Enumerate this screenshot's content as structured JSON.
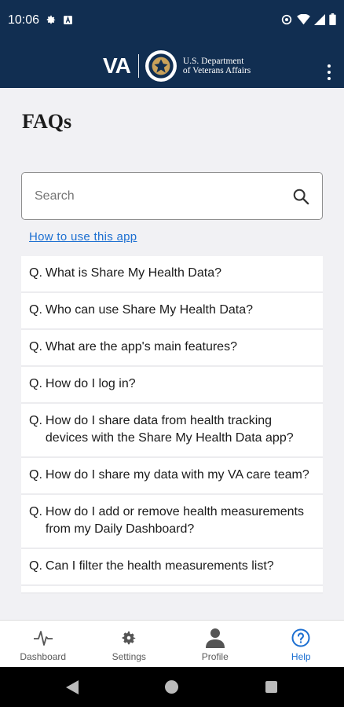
{
  "status_bar": {
    "time": "10:06"
  },
  "header": {
    "logo_mark": "VA",
    "dept_line1": "U.S. Department",
    "dept_line2": "of Veterans Affairs"
  },
  "page": {
    "title": "FAQs"
  },
  "search": {
    "placeholder": "Search",
    "value": ""
  },
  "help_link": "How to use this app",
  "faq_prefix": "Q.",
  "faqs": [
    "What is Share My Health Data?",
    "Who can use Share My Health Data?",
    "What are the app's main features?",
    "How do I log in?",
    "How do I share data from health tracking devices with the Share My Health Data app?",
    "How do I share my data with my VA care team?",
    "How do I add or remove health measurements from my Daily Dashboard?",
    "Can I filter the health measurements list?"
  ],
  "bottom_nav": {
    "items": [
      {
        "label": "Dashboard",
        "icon": "pulse-icon",
        "active": false
      },
      {
        "label": "Settings",
        "icon": "gear-icon",
        "active": false
      },
      {
        "label": "Profile",
        "icon": "person-icon",
        "active": false
      },
      {
        "label": "Help",
        "icon": "help-circle-icon",
        "active": true
      }
    ],
    "active_color": "#1c6fd1"
  },
  "colors": {
    "header_bg": "#112e51",
    "link": "#1c6fd1",
    "page_bg": "#f1f1f4"
  }
}
